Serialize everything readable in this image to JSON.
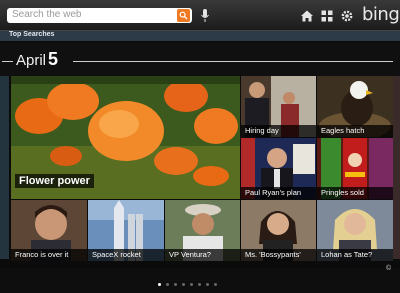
{
  "search": {
    "placeholder": "Search the web"
  },
  "brand": {
    "logo_text": "bing"
  },
  "section": {
    "label": "Top Searches"
  },
  "date": {
    "month": "April",
    "day": "5"
  },
  "featured": {
    "caption": "Flower power"
  },
  "tiles": [
    {
      "caption": "Hiring day"
    },
    {
      "caption": "Eagles hatch"
    },
    {
      "caption": "Paul Ryan's plan"
    },
    {
      "caption": "Pringles sold"
    },
    {
      "caption": "Franco is over it"
    },
    {
      "caption": "SpaceX rocket"
    },
    {
      "caption": "VP Ventura?"
    },
    {
      "caption": "Ms. 'Bossypants'"
    },
    {
      "caption": "Lohan as Tate?"
    }
  ],
  "pager": {
    "page_count": 8,
    "current": 1
  },
  "footer": {
    "copyright": "©"
  },
  "colors": {
    "accent": "#f07a22",
    "section_bar": "#2d3a48"
  },
  "icons": [
    "search-go-icon",
    "microphone-icon",
    "home-icon",
    "grid-icon",
    "gear-icon"
  ]
}
